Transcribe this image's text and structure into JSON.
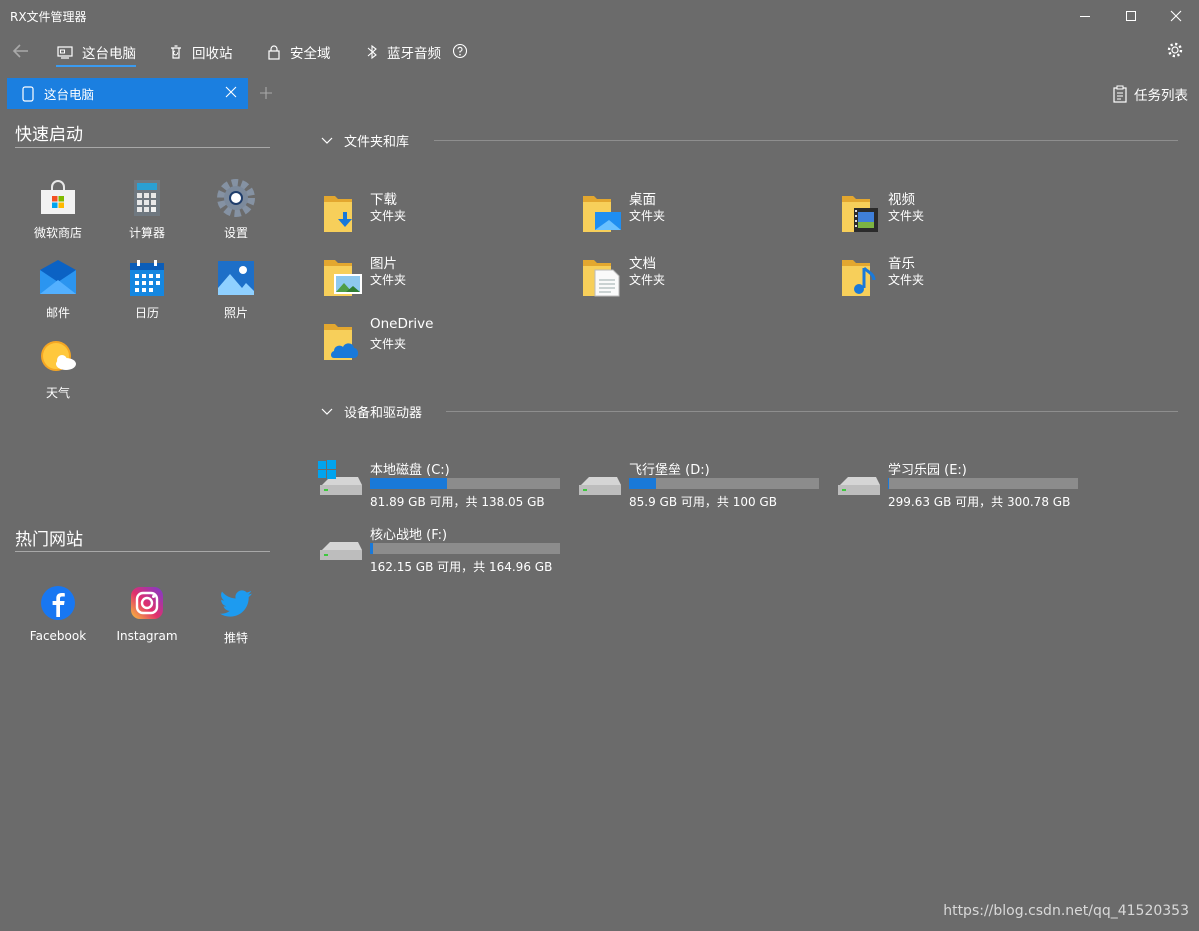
{
  "window": {
    "title": "RX文件管理器"
  },
  "nav": {
    "back_icon": "arrow-left-icon",
    "tabs": [
      {
        "label": "这台电脑",
        "icon": "computer-icon",
        "active": true
      },
      {
        "label": "回收站",
        "icon": "recycle-bin-icon"
      },
      {
        "label": "安全域",
        "icon": "lock-icon"
      },
      {
        "label": "蓝牙音频",
        "icon": "bluetooth-icon"
      }
    ],
    "help_icon": "help-icon",
    "settings_icon": "gear-icon"
  },
  "tabstrip": {
    "active_tab": "这台电脑",
    "add_icon": "plus-icon",
    "task_list_label": "任务列表"
  },
  "sidebar": {
    "quick_launch": {
      "title": "快速启动",
      "apps": [
        {
          "label": "微软商店",
          "icon": "store-icon"
        },
        {
          "label": "计算器",
          "icon": "calculator-icon"
        },
        {
          "label": "设置",
          "icon": "settings-icon"
        },
        {
          "label": "邮件",
          "icon": "mail-icon"
        },
        {
          "label": "日历",
          "icon": "calendar-icon"
        },
        {
          "label": "照片",
          "icon": "photos-icon"
        },
        {
          "label": "天气",
          "icon": "weather-icon"
        }
      ]
    },
    "hot_sites": {
      "title": "热门网站",
      "sites": [
        {
          "label": "Facebook",
          "icon": "facebook-icon"
        },
        {
          "label": "Instagram",
          "icon": "instagram-icon"
        },
        {
          "label": "推特",
          "icon": "twitter-icon"
        }
      ]
    }
  },
  "main": {
    "folders_section": {
      "title": "文件夹和库",
      "items": [
        {
          "name": "下载",
          "type": "文件夹",
          "icon": "downloads-folder-icon"
        },
        {
          "name": "桌面",
          "type": "文件夹",
          "icon": "desktop-folder-icon"
        },
        {
          "name": "视频",
          "type": "文件夹",
          "icon": "videos-folder-icon"
        },
        {
          "name": "图片",
          "type": "文件夹",
          "icon": "pictures-folder-icon"
        },
        {
          "name": "文档",
          "type": "文件夹",
          "icon": "documents-folder-icon"
        },
        {
          "name": "音乐",
          "type": "文件夹",
          "icon": "music-folder-icon"
        },
        {
          "name": "OneDrive",
          "type": "文件夹",
          "icon": "onedrive-folder-icon"
        }
      ]
    },
    "drives_section": {
      "title": "设备和驱动器",
      "items": [
        {
          "name": "本地磁盘 (C:)",
          "free": "81.89 GB 可用，共 138.05 GB",
          "used_fraction": 0.407,
          "icon": "system-drive-icon"
        },
        {
          "name": "飞行堡垒 (D:)",
          "free": "85.9 GB 可用，共 100 GB",
          "used_fraction": 0.141,
          "icon": "drive-icon"
        },
        {
          "name": "学习乐园 (E:)",
          "free": "299.63 GB 可用，共 300.78 GB",
          "used_fraction": 0.004,
          "icon": "drive-icon"
        },
        {
          "name": "核心战地 (F:)",
          "free": "162.15 GB 可用，共 164.96 GB",
          "used_fraction": 0.017,
          "icon": "drive-icon"
        }
      ]
    }
  },
  "watermark": "https://blog.csdn.net/qq_41520353",
  "colors": {
    "background": "#6b6b6b",
    "accent": "#1b7fe0",
    "progress": "#1979d9",
    "folder": "#f5c94d"
  }
}
